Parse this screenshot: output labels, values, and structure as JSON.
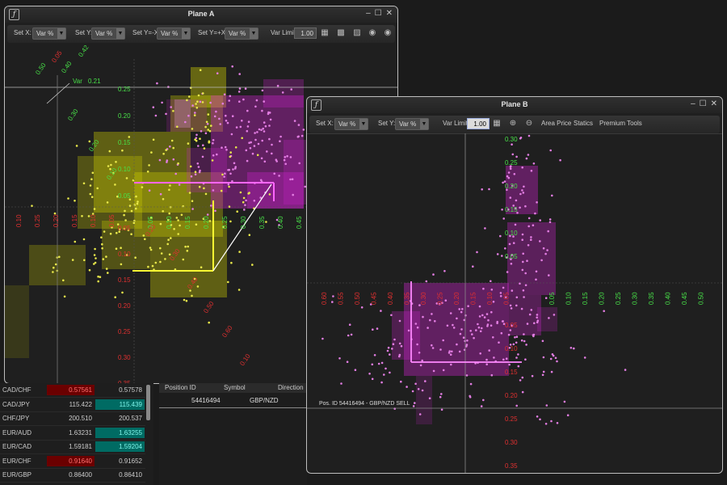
{
  "planeA": {
    "title": "Plane A",
    "toolbar": {
      "setx_label": "Set X:",
      "setx_value": "Var %",
      "sety_label": "Set Y:",
      "sety_value": "Var %",
      "setyx_label": "Set Y=-X:",
      "setyx_value": "Var %",
      "setyx2_label": "Set Y=+X:",
      "setyx2_value": "Var %",
      "varlimit_label": "Var Limit",
      "varlimit_value": "1.00"
    },
    "var_label": "Var",
    "var_value": "0.21",
    "x_axis_red": [
      "0.10",
      "0.25",
      "0.20",
      "0.15",
      "0.10",
      "0.05"
    ],
    "x_axis_green": [
      "0.05",
      "0.10",
      "0.15",
      "0.20",
      "0.25",
      "0.30",
      "0.35",
      "0.40",
      "0.45"
    ],
    "y_axis_green": [
      "0.25",
      "0.20",
      "0.15",
      "0.10",
      "0.05"
    ],
    "y_axis_red": [
      "0.05",
      "0.10",
      "0.15",
      "0.20",
      "0.25",
      "0.30",
      "0.35"
    ],
    "diag_green": [
      "0.42",
      "0.40",
      "0.30",
      "0.20",
      "0.10",
      "0.50"
    ],
    "diag_red": [
      "0.20",
      "0.30",
      "0.40",
      "0.50",
      "0.60",
      "0.10",
      "0.05"
    ],
    "yellow_color": "#d8d800",
    "magenta_color": "#cc22cc"
  },
  "planeB": {
    "title": "Plane B",
    "toolbar": {
      "setx_label": "Set X:",
      "setx_value": "Var %",
      "sety_label": "Set Y:",
      "sety_value": "Var %",
      "varlimit_label": "Var Limit",
      "varlimit_value": "1.00",
      "area_price": "Area Price",
      "statics": "Statics",
      "premium_tools": "Premium Tools"
    },
    "x_axis_red": [
      "0.60",
      "0.55",
      "0.50",
      "0.45",
      "0.40",
      "0.35",
      "0.30",
      "0.25",
      "0.20",
      "0.15",
      "0.10",
      "0.05"
    ],
    "x_axis_green": [
      "0.05",
      "0.10",
      "0.15",
      "0.20",
      "0.25",
      "0.30",
      "0.35",
      "0.40",
      "0.45",
      "0.50"
    ],
    "y_axis_green": [
      "0.30",
      "0.25",
      "0.20",
      "0.15",
      "0.10",
      "0.05"
    ],
    "y_axis_red": [
      "0.05",
      "0.10",
      "0.15",
      "0.20",
      "0.25",
      "0.30",
      "0.35"
    ],
    "position_info": "Pos. ID 54416494 - GBP/NZD SELL"
  },
  "quotes": [
    {
      "symbol": "CAD/CHF",
      "bid": "0.57561",
      "ask": "0.57578",
      "bid_style": "neg",
      "ask_style": ""
    },
    {
      "symbol": "CAD/JPY",
      "bid": "115.422",
      "ask": "115.439",
      "bid_style": "",
      "ask_style": "pos"
    },
    {
      "symbol": "CHF/JPY",
      "bid": "200.510",
      "ask": "200.537",
      "bid_style": "",
      "ask_style": ""
    },
    {
      "symbol": "EUR/AUD",
      "bid": "1.63231",
      "ask": "1.63255",
      "bid_style": "",
      "ask_style": "pos"
    },
    {
      "symbol": "EUR/CAD",
      "bid": "1.59181",
      "ask": "1.59204",
      "bid_style": "",
      "ask_style": "pos"
    },
    {
      "symbol": "EUR/CHF",
      "bid": "0.91640",
      "ask": "0.91652",
      "bid_style": "neg",
      "ask_style": ""
    },
    {
      "symbol": "EUR/GBP",
      "bid": "0.86400",
      "ask": "0.86410",
      "bid_style": "",
      "ask_style": ""
    }
  ],
  "positions": {
    "headers": [
      "Position ID",
      "Symbol",
      "Direction"
    ],
    "row": {
      "id": "54416494",
      "symbol": "GBP/NZD"
    }
  }
}
